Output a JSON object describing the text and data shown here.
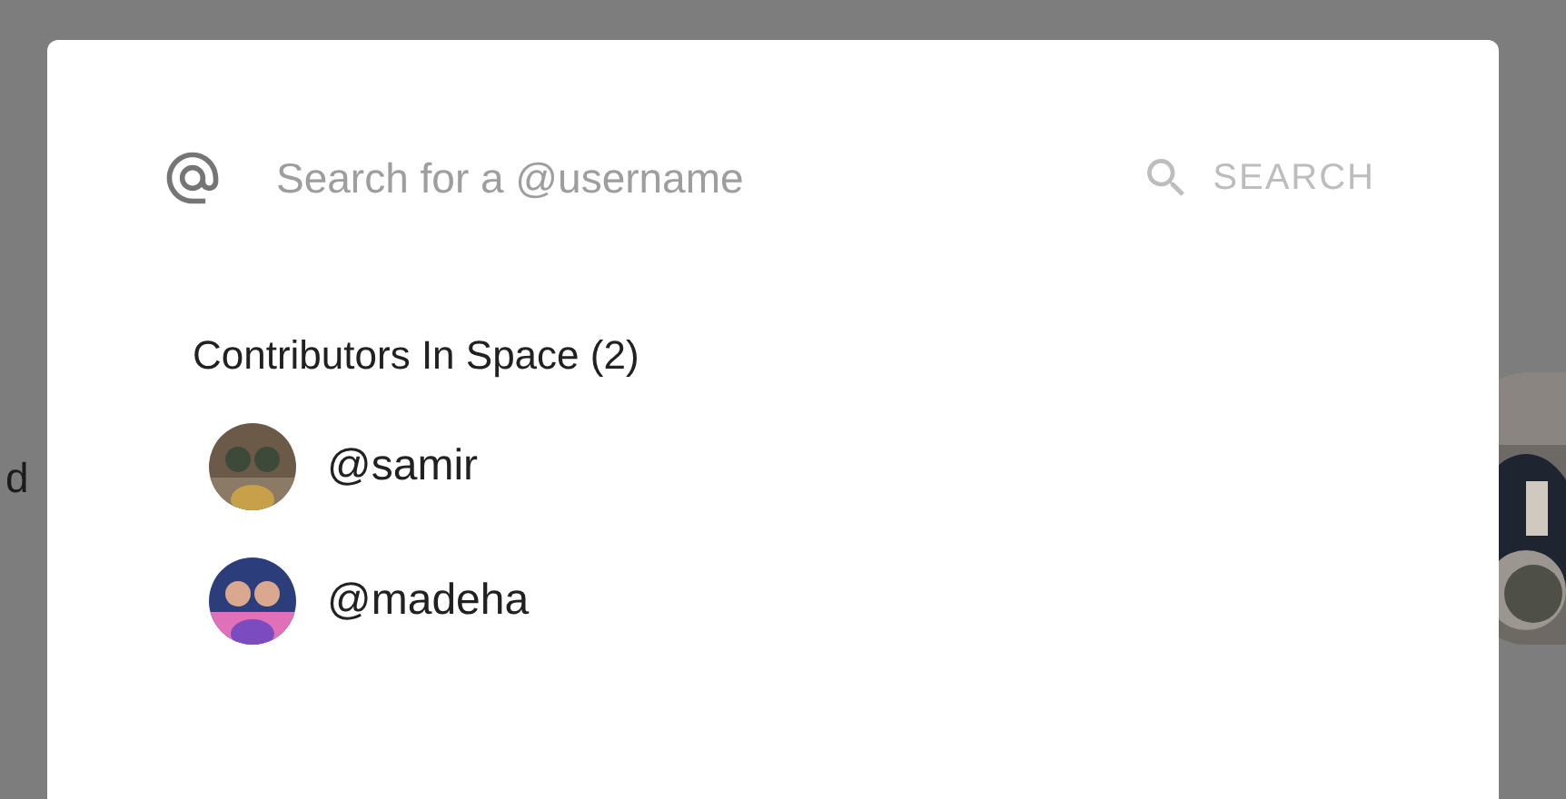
{
  "background_page": {
    "text_fragment": "d"
  },
  "dialog": {
    "search": {
      "placeholder": "Search for a @username",
      "button": "SEARCH"
    },
    "section_title": "Contributors In Space (2)",
    "contributors": [
      {
        "username": "@samir"
      },
      {
        "username": "@madeha"
      }
    ]
  }
}
